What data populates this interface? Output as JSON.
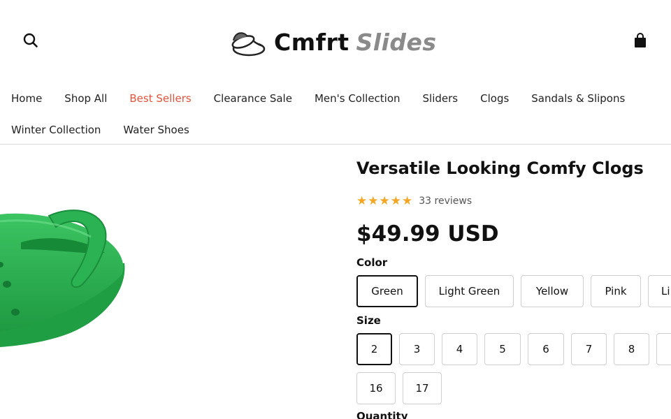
{
  "brand": {
    "name_part1": "Cmfrt",
    "name_part2": "Slides",
    "logo_icon": "slippers-icon"
  },
  "header": {
    "search_icon": "search-icon",
    "cart_icon": "shopping-bag-icon"
  },
  "nav": {
    "row1": [
      {
        "label": "Home",
        "active": false
      },
      {
        "label": "Shop All",
        "active": false
      },
      {
        "label": "Best Sellers",
        "active": true
      },
      {
        "label": "Clearance Sale",
        "active": false
      },
      {
        "label": "Men's Collection",
        "active": false
      },
      {
        "label": "Sliders",
        "active": false
      },
      {
        "label": "Clogs",
        "active": false
      },
      {
        "label": "Sandals & Slipons",
        "active": false
      }
    ],
    "row2": [
      {
        "label": "Winter Collection",
        "active": false
      },
      {
        "label": "Water Shoes",
        "active": false
      }
    ]
  },
  "product": {
    "title": "Versatile Looking Comfy Clogs",
    "rating_stars": 5,
    "reviews_text": "33 reviews",
    "price": "$49.99 USD",
    "color_label": "Color",
    "colors": [
      "Green",
      "Light Green",
      "Yellow",
      "Pink",
      "Li"
    ],
    "selected_color": "Green",
    "size_label": "Size",
    "sizes_row1": [
      "2",
      "3",
      "4",
      "5",
      "6",
      "7",
      "8",
      ""
    ],
    "sizes_row2": [
      "16",
      "17"
    ],
    "selected_size": "2",
    "quantity_label": "Quantity",
    "image_subject": "green clog",
    "accent_color": "#e4533b",
    "star_color": "#f5a623",
    "shoe_color": "#2fb552"
  }
}
